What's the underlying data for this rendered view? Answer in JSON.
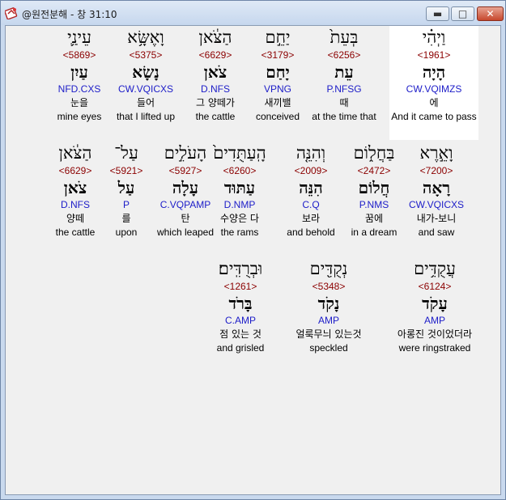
{
  "window": {
    "title": "@원전분해 - 창 31:10"
  },
  "controls": {
    "minimize": "▬",
    "maximize": "□",
    "close": "✕"
  },
  "rows": [
    [
      {
        "heb": "וַיְהִ֗י",
        "strong": "<1961>",
        "lex": "הָיָה",
        "parse": "CW.VQIMZS",
        "kor": "에",
        "eng": "And it came to pass"
      },
      {
        "heb": "בְּעֵת֙",
        "strong": "<6256>",
        "lex": "עֵת",
        "parse": "P.NFSG",
        "kor": "때",
        "eng": "at the time that"
      },
      {
        "heb": "יַחֵ֣ם",
        "strong": "<3179>",
        "lex": "יָחַם",
        "parse": "VPNG",
        "kor": "새끼밸",
        "eng": "conceived"
      },
      {
        "heb": "הַצֹּ֔אן",
        "strong": "<6629>",
        "lex": "צֹאן",
        "parse": "D.NFS",
        "kor": "그 양떼가",
        "eng": "the cattle"
      },
      {
        "heb": "וָאֶשָּׂ֥א",
        "strong": "<5375>",
        "lex": "נָשָׂא",
        "parse": "CW.VQICXS",
        "kor": "들어",
        "eng": "that I lifted up"
      },
      {
        "heb": "עֵינַ֛י",
        "strong": "<5869>",
        "lex": "עַיִן",
        "parse": "NFD.CXS",
        "kor": "눈을",
        "eng": "mine eyes"
      }
    ],
    [
      {
        "heb": "וָאֵ֣רֶא",
        "strong": "<7200>",
        "lex": "רָאָה",
        "parse": "CW.VQICXS",
        "kor": "내가-보니",
        "eng": "and saw"
      },
      {
        "heb": "בַּחֲל֑וֹם",
        "strong": "<2472>",
        "lex": "חֲלוֹם",
        "parse": "P.NMS",
        "kor": "꿈에",
        "eng": "in a dream"
      },
      {
        "heb": "וְהִנֵּ֤ה",
        "strong": "<2009>",
        "lex": "הִנֵּה",
        "parse": "C.Q",
        "kor": "보라",
        "eng": "and behold"
      },
      {
        "heb": "הָֽעַתֻּדִים֙",
        "strong": "<6260>",
        "lex": "עַתּוּד",
        "parse": "D.NMP",
        "kor": "수양은 다",
        "eng": "the rams"
      },
      {
        "heb": "הָעֹלִ֣ים",
        "strong": "<5927>",
        "lex": "עָלָה",
        "parse": "C.VQPAMP",
        "kor": "탄",
        "eng": "which leaped"
      },
      {
        "heb": "עַל־",
        "strong": "<5921>",
        "lex": "עַל",
        "parse": "P",
        "kor": "를",
        "eng": "upon"
      },
      {
        "heb": "הַצֹּ֔אן",
        "strong": "<6629>",
        "lex": "צֹאן",
        "parse": "D.NFS",
        "kor": "양떼",
        "eng": "the cattle"
      }
    ],
    [
      {
        "heb": "עֲקֻדִּ֥ים",
        "strong": "<6124>",
        "lex": "עָקֹד",
        "parse": "AMP",
        "kor": "아롱진 것이었더라",
        "eng": "were ringstraked"
      },
      {
        "heb": "נְקֻדִּ֖ים",
        "strong": "<5348>",
        "lex": "נָקֹד",
        "parse": "AMP",
        "kor": "얼룩무늬 있는것",
        "eng": "speckled"
      },
      {
        "heb": "וּבְרֻדִּֽים׃",
        "strong": "<1261>",
        "lex": "בָּרֹד",
        "parse": "C.AMP",
        "kor": "점 있는 것",
        "eng": "and grisled"
      }
    ]
  ]
}
